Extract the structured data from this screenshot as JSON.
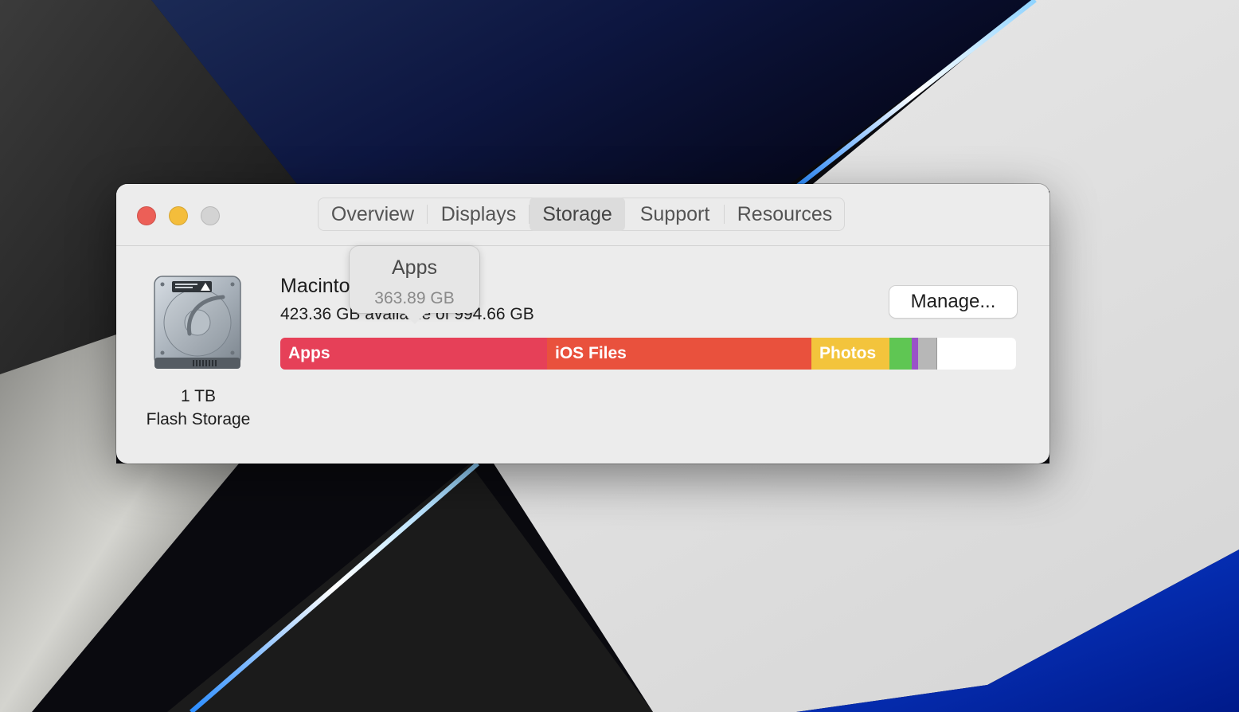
{
  "window": {
    "tabs": [
      {
        "label": "Overview"
      },
      {
        "label": "Displays"
      },
      {
        "label": "Storage"
      },
      {
        "label": "Support"
      },
      {
        "label": "Resources"
      }
    ],
    "active_tab": "Storage"
  },
  "disk": {
    "capacity": "1 TB",
    "type": "Flash Storage",
    "icon": "hard-drive-icon"
  },
  "volume": {
    "name": "Macintosh HD",
    "detail": "423.36 GB available of 994.66 GB"
  },
  "manage_button": {
    "label": "Manage..."
  },
  "storage_bar": {
    "segments": [
      {
        "label": "Apps",
        "color": "#e64058"
      },
      {
        "label": "iOS Files",
        "color": "#e9513d"
      },
      {
        "label": "Photos",
        "color": "#f3c43c"
      },
      {
        "label": "",
        "color": "#5fc653"
      },
      {
        "label": "",
        "color": "#9a52c8"
      },
      {
        "label": "",
        "color": "#b7b7b7"
      }
    ]
  },
  "tooltip": {
    "title": "Apps",
    "size": "363.89 GB"
  }
}
